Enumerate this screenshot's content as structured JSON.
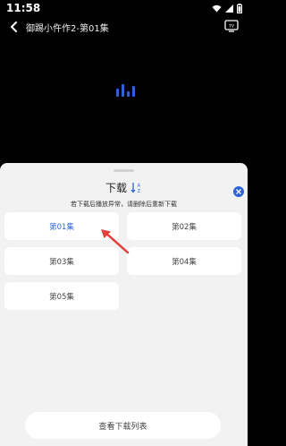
{
  "status": {
    "time": "11:58"
  },
  "header": {
    "title": "御踢小仵作2-第01集"
  },
  "sheet": {
    "title": "下载",
    "hint": "若下载后播放异常，请删除后重新下载",
    "episodes": [
      {
        "label": "第01集",
        "selected": true
      },
      {
        "label": "第02集",
        "selected": false
      },
      {
        "label": "第03集",
        "selected": false
      },
      {
        "label": "第04集",
        "selected": false
      },
      {
        "label": "第05集",
        "selected": false
      }
    ],
    "view_list_label": "查看下载列表"
  },
  "colors": {
    "accent": "#2f64d8",
    "arrow": "#e0413a",
    "sheet_bg": "#f2f2f3"
  },
  "icons": [
    "back-icon",
    "tv-cast-icon",
    "wifi-icon",
    "signal-icon",
    "battery-icon",
    "sort-icon",
    "close-icon",
    "loading-bars-icon"
  ]
}
